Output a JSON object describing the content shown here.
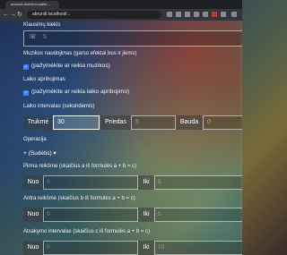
{
  "browser": {
    "tab_title": "android-triukšmo-kalibr…",
    "url": "abrunill.localhost/..."
  },
  "form": {
    "phone_label": "Klausimų kiekis",
    "phone_value": "5",
    "music_label": "Muzikos naudojimas (garso efektai bus ir jiems)",
    "music_checkbox": "(pažymėkite ar reikia muzikos)",
    "time_label": "Laiko apribojimas",
    "time_checkbox": "(pažymėkite ar reikia laiko apribojimo)",
    "interval_label": "Laiko intervalas (sekundėmis)",
    "duration_addon": "Trukmė",
    "duration_value": "30",
    "rest_addon": "Priedas",
    "rest_value": "5",
    "penalty_addon": "Bauda",
    "penalty_value": "0",
    "operation_label": "Operacija",
    "operation_value": "+ (Sudėtis) ▾",
    "first_range_label": "Pirma reikšmė (skaičius a iš formulės a + b = c)",
    "second_range_label": "Antra reikšmė (skaičius b iš formulės a + b = c)",
    "answer_range_label": "Atsakymo intervalas (skaičius c iš formulės a + b = c)",
    "from_addon": "Nuo",
    "to_addon": "Iki",
    "first_from": "0",
    "first_to": "5",
    "second_from": "0",
    "second_to": "5",
    "answer_from": "0",
    "answer_to": "10"
  }
}
